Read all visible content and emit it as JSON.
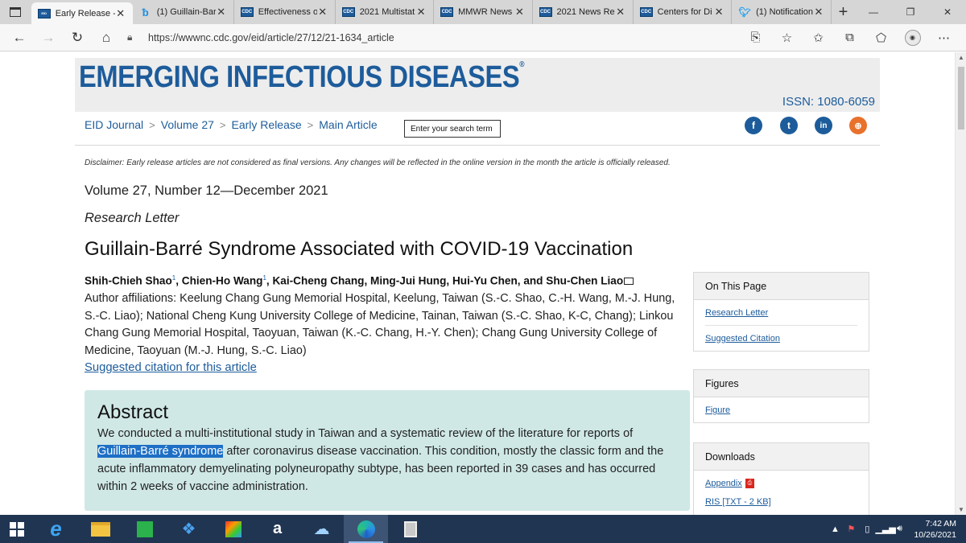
{
  "browser": {
    "tabs": [
      {
        "label": "Early Release - ",
        "favicon": "emerging-infectious-diseases-icon",
        "active": true
      },
      {
        "label": "(1) Guillain-Bar",
        "favicon": "bing-icon",
        "active": false
      },
      {
        "label": "Effectiveness o",
        "favicon": "cdc-icon",
        "active": false
      },
      {
        "label": "2021 Multistat",
        "favicon": "cdc-icon",
        "active": false
      },
      {
        "label": "MMWR News",
        "favicon": "cdc-icon",
        "active": false
      },
      {
        "label": "2021 News Re",
        "favicon": "cdc-icon",
        "active": false
      },
      {
        "label": "Centers for Di",
        "favicon": "cdc-icon",
        "active": false
      },
      {
        "label": "(1) Notification",
        "favicon": "twitter-icon",
        "active": false
      }
    ],
    "cdc_favicon_text": "CDC",
    "new_tab_glyph": "+",
    "url": "https://wwwnc.cdc.gov/eid/article/27/12/21-1634_article"
  },
  "page": {
    "masthead_title": "EMERGING INFECTIOUS DISEASES",
    "registered_mark": "®",
    "issn": "ISSN: 1080-6059",
    "breadcrumbs": [
      "EID Journal",
      "Volume 27",
      "Early Release",
      "Main Article"
    ],
    "breadcrumb_separator": ">",
    "search_placeholder": "Enter your search term",
    "disclaimer": "Disclaimer: Early release articles are not considered as final versions. Any changes will be reflected in the online version in the month the article is officially released.",
    "volume": "Volume 27, Number 12—December 2021",
    "article_type": "Research Letter",
    "title": "Guillain-Barré Syndrome Associated with COVID-19 Vaccination",
    "authors": {
      "a1": "Shih-Chieh Shao",
      "a1_sup": "1",
      "a2": ", Chien-Ho Wang",
      "a2_sup": "1",
      "rest": ", Kai-Cheng Chang, Ming-Jui Hung, Hui-Yu Chen, and Shu-Chen Liao"
    },
    "affiliations": "Author affiliations: Keelung Chang Gung Memorial Hospital, Keelung, Taiwan (S.-C. Shao, C.-H. Wang, M.-J. Hung, S.-C. Liao); National Cheng Kung University College of Medicine, Tainan, Taiwan (S.-C. Shao, K-C, Chang); Linkou Chang Gung Memorial Hospital, Taoyuan, Taiwan (K.-C. Chang, H.-Y. Chen); Chang Gung University College of Medicine, Taoyuan (M.-J. Hung, S.-C. Liao)",
    "suggested_citation_link": "Suggested citation for this article",
    "abstract": {
      "heading": "Abstract",
      "text_before": "We conducted a multi-institutional study in Taiwan and a systematic review of the literature for reports of ",
      "highlight": "Guillain-Barré syndrome",
      "text_after": " after coronavirus disease vaccination. This condition, mostly the classic form and the acute inflammatory demyelinating polyneuropathy subtype, has been reported in 39 cases and has occurred within 2 weeks of vaccine administration."
    },
    "sidebar": {
      "on_this_page": {
        "heading": "On This Page",
        "links": [
          "Research Letter",
          "Suggested Citation"
        ]
      },
      "figures": {
        "heading": "Figures",
        "links": [
          "Figure"
        ]
      },
      "downloads": {
        "heading": "Downloads",
        "links": [
          "Appendix",
          "RIS [TXT - 2 KB]"
        ]
      }
    },
    "social_icons": [
      "facebook-icon",
      "twitter-icon",
      "linkedin-icon",
      "syndicate-icon"
    ],
    "social_glyphs": {
      "facebook": "f",
      "twitter": "t",
      "linkedin": "in",
      "syndicate": "⊕"
    }
  },
  "taskbar": {
    "apps": [
      "internet-explorer-icon",
      "file-explorer-icon",
      "store-icon",
      "dropbox-icon",
      "paint-icon",
      "amazon-icon",
      "cloud-icon",
      "edge-icon",
      "calculator-icon"
    ],
    "amazon_glyph": "a",
    "clock_time": "7:42 AM",
    "clock_date": "10/26/2021"
  },
  "colors": {
    "brand_blue": "#1d5c9b",
    "abstract_bg": "#cfe8e6",
    "selection_highlight": "#1e6fc6",
    "taskbar_bg": "#203552"
  }
}
